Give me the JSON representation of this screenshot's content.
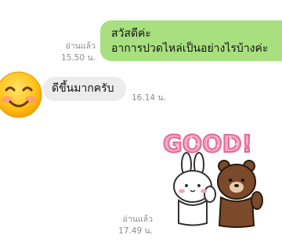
{
  "messages": [
    {
      "direction": "outgoing",
      "lines": [
        "สวัสดีค่ะ",
        "อาการปวดไหล่เป็นอย่างไรบ้างค่ะ"
      ],
      "read_label": "อ่านแล้ว",
      "time": "15.50 น."
    },
    {
      "direction": "incoming",
      "text": "ดีขึ้นมากครับ",
      "time": "16.14 น.",
      "avatar_icon": "smiling-face-emoji-icon"
    },
    {
      "direction": "outgoing",
      "sticker": {
        "icon": "good-sticker-bear-bunny-icon",
        "text": "GOOD!"
      },
      "read_label": "อ่านแล้ว",
      "time": "17.49 น."
    }
  ],
  "colors": {
    "outgoing_bubble": "#a8e07f",
    "incoming_bubble": "#ececec",
    "meta_text": "#8c8c8c",
    "sticker_letters": "#f48fb1"
  }
}
